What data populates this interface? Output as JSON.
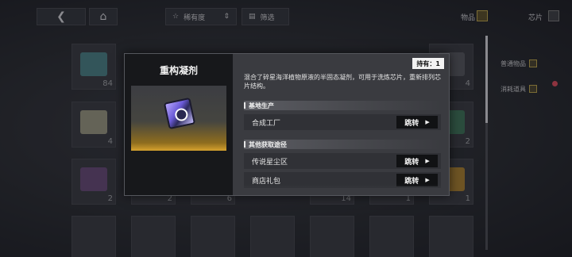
{
  "topbar": {
    "back_icon": "back-arrow-icon",
    "home_icon": "home-icon",
    "rarity_label": "稀有度",
    "filter_label": "筛选",
    "tabs": [
      {
        "label": "物品"
      },
      {
        "label": "芯片"
      }
    ]
  },
  "sidebar": {
    "categories": [
      {
        "label": "普通物品"
      },
      {
        "label": "消耗道具"
      }
    ]
  },
  "grid": {
    "counts": [
      "84",
      "4",
      "4",
      "1",
      "2",
      "6",
      "2",
      "14",
      "1",
      "2",
      "1",
      "1"
    ]
  },
  "modal": {
    "title": "重构凝剂",
    "held_label": "持有：1",
    "description": "混合了碎星海洋植物原液的半固态凝剂，可用于洗炼芯片，重新排列芯片结构。",
    "sections": [
      {
        "heading": "基地生产",
        "sources": [
          {
            "label": "合成工厂",
            "button": "跳转"
          }
        ]
      },
      {
        "heading": "其他获取途径",
        "sources": [
          {
            "label": "传说星尘区",
            "button": "跳转"
          },
          {
            "label": "商店礼包",
            "button": "跳转"
          }
        ]
      }
    ]
  },
  "colors": {
    "accent_gold": "#d6a22e",
    "badge_red": "#d64b5a"
  }
}
